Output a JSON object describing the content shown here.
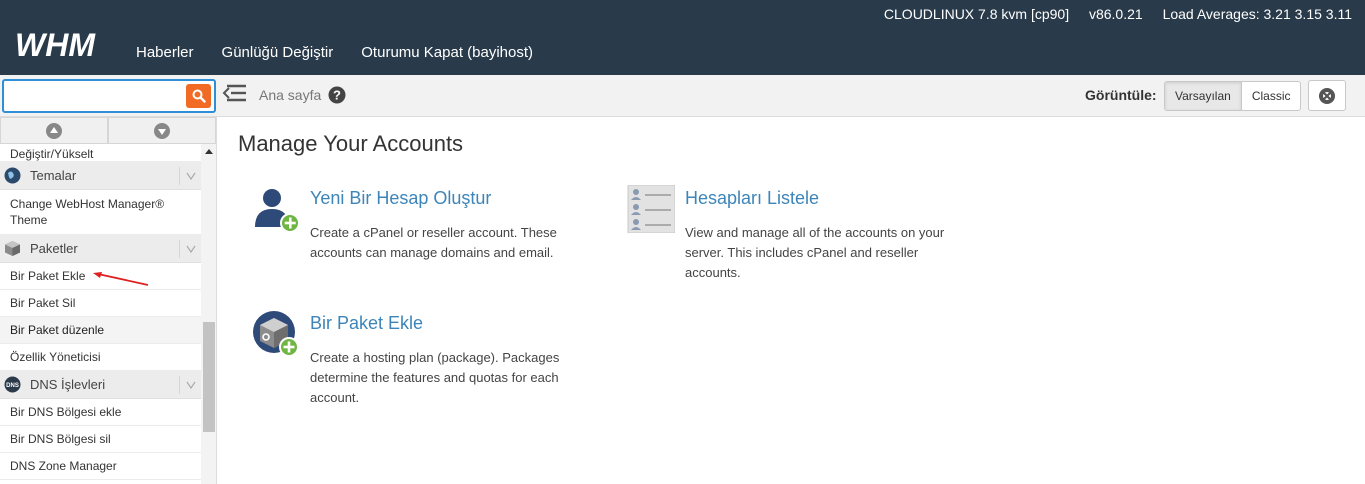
{
  "header": {
    "sysinfo": [
      "CLOUDLINUX 7.8 kvm [cp90]",
      "v86.0.21",
      "Load Averages: 3.21 3.15 3.11"
    ],
    "logo_text": "WHM",
    "nav": [
      "Haberler",
      "Günlüğü Değiştir",
      "Oturumu Kapat (bayihost)"
    ]
  },
  "toolbar": {
    "search_value": "",
    "breadcrumb": "Ana sayfa",
    "view_label": "Görüntüle:",
    "view_options": [
      "Varsayılan",
      "Classic"
    ],
    "view_selected": "Varsayılan"
  },
  "sidebar": {
    "partial_top": "Değiştir/Yükselt",
    "cat_temalar": "Temalar",
    "temalar_item": "Change WebHost Manager® Theme",
    "cat_paketler": "Paketler",
    "paket_items": [
      "Bir Paket Ekle",
      "Bir Paket Sil",
      "Bir Paket düzenle",
      "Özellik Yöneticisi"
    ],
    "cat_dns": "DNS İşlevleri",
    "dns_items": [
      "Bir DNS Bölgesi ekle",
      "Bir DNS Bölgesi sil",
      "DNS Zone Manager"
    ],
    "dns_badge": "DNS"
  },
  "main": {
    "title": "Manage Your Accounts",
    "cards": [
      {
        "title": "Yeni Bir Hesap Oluştur",
        "desc": "Create a cPanel or reseller account. These accounts can manage domains and email."
      },
      {
        "title": "Hesapları Listele",
        "desc": "View and manage all of the accounts on your server. This includes cPanel and reseller accounts."
      },
      {
        "title": "Bir Paket Ekle",
        "desc": "Create a hosting plan (package). Packages determine the features and quotas for each account."
      }
    ]
  },
  "colors": {
    "header_bg": "#293a4a",
    "accent_link": "#3d85b8",
    "search_btn": "#f26b24",
    "search_border": "#2e8fd6",
    "annotation_arrow": "#e02020"
  }
}
